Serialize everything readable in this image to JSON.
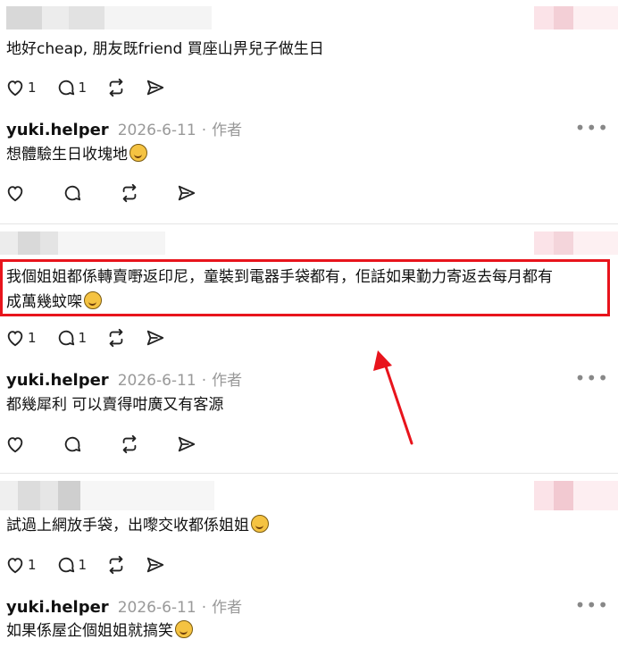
{
  "colors": {
    "highlight": "#e8141c",
    "arrow": "#e8141c",
    "meta": "#999999"
  },
  "posts": [
    {
      "text": "地好cheap, 朋友既friend 買座山畀兒子做生日",
      "likes": "1",
      "comments": "1",
      "reply": {
        "author": "yuki.helper",
        "date": "2026-6-11",
        "sep": "·",
        "role": "作者",
        "text": "想體驗生日收塊地"
      }
    },
    {
      "text_line1": "我個姐姐都係轉賣嘢返印尼，童裝到電器手袋都有，佢話如果勤力寄返去每月都有",
      "text_line2": "成萬幾蚊㗎",
      "likes": "1",
      "comments": "1",
      "reply": {
        "author": "yuki.helper",
        "date": "2026-6-11",
        "sep": "·",
        "role": "作者",
        "text": "都幾犀利 可以賣得咁廣又有客源"
      }
    },
    {
      "text": "試過上網放手袋，出嚟交收都係姐姐",
      "likes": "1",
      "comments": "1",
      "reply": {
        "author": "yuki.helper",
        "date": "2026-6-11",
        "sep": "·",
        "role": "作者",
        "text": "如果係屋企個姐姐就搞笑"
      }
    }
  ],
  "icons": {
    "like": "heart-icon",
    "comment": "comment-icon",
    "repost": "repost-icon",
    "share": "send-icon",
    "more": "more-icon",
    "emoji": "laughing-emoji-icon"
  },
  "more_label": "•••"
}
